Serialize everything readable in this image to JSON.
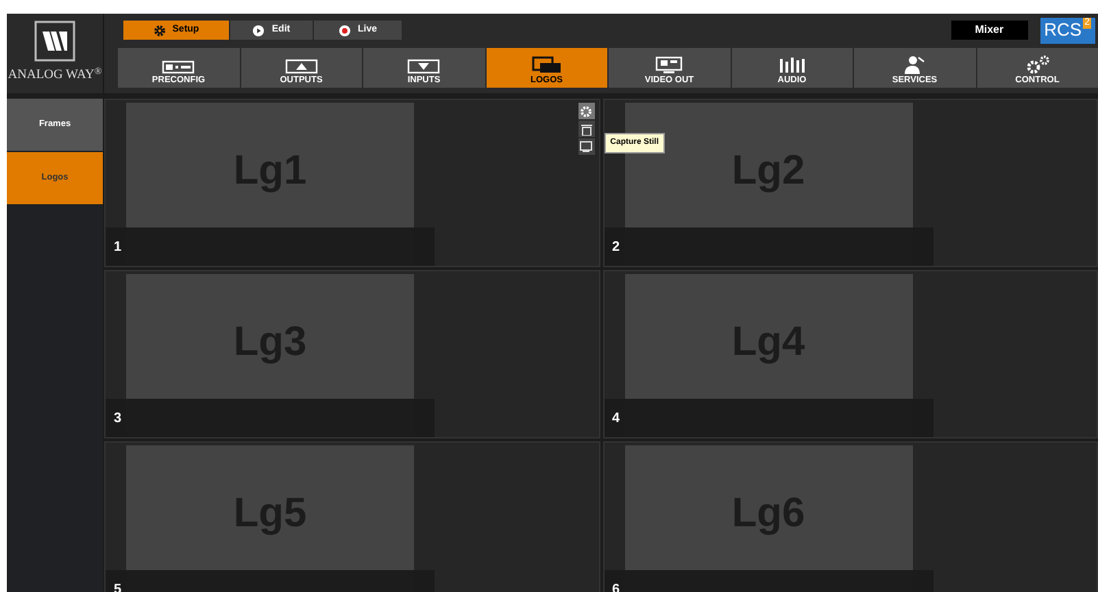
{
  "brand": {
    "name": "ANALOG WAY",
    "mark": "®"
  },
  "modes": [
    {
      "label": "Setup",
      "selected": true
    },
    {
      "label": "Edit",
      "selected": false
    },
    {
      "label": "Live",
      "selected": false
    }
  ],
  "mixer": "Mixer",
  "rcs": {
    "label": "RCS",
    "sup": "2"
  },
  "nav": [
    {
      "label": "PRECONFIG",
      "selected": false
    },
    {
      "label": "OUTPUTS",
      "selected": false
    },
    {
      "label": "INPUTS",
      "selected": false
    },
    {
      "label": "LOGOS",
      "selected": true
    },
    {
      "label": "VIDEO OUT",
      "selected": false
    },
    {
      "label": "AUDIO",
      "selected": false
    },
    {
      "label": "SERVICES",
      "selected": false
    },
    {
      "label": "CONTROL",
      "selected": false
    }
  ],
  "sidebar": [
    {
      "label": "Frames",
      "selected": false
    },
    {
      "label": "Logos",
      "selected": true
    }
  ],
  "tiles": [
    {
      "preview": "Lg1",
      "number": "1"
    },
    {
      "preview": "Lg2",
      "number": "2"
    },
    {
      "preview": "Lg3",
      "number": "3"
    },
    {
      "preview": "Lg4",
      "number": "4"
    },
    {
      "preview": "Lg5",
      "number": "5"
    },
    {
      "preview": "Lg6",
      "number": "6"
    }
  ],
  "tooltip": "Capture Still"
}
